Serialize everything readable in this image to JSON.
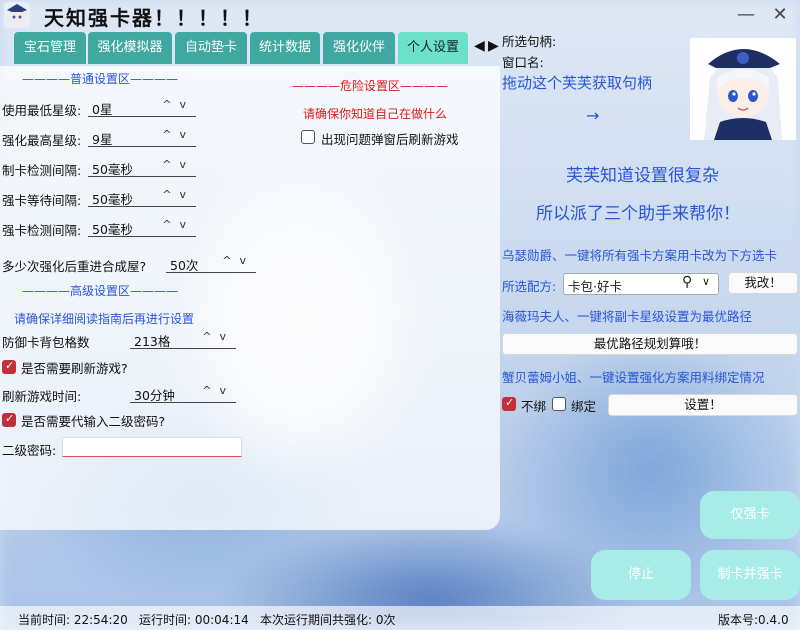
{
  "app": {
    "title": "天知强卡器！！！！！",
    "minimize_label": "—",
    "close_label": "✕"
  },
  "tabs": [
    {
      "label": "宝石管理"
    },
    {
      "label": "强化模拟器"
    },
    {
      "label": "自动垫卡"
    },
    {
      "label": "统计数据"
    },
    {
      "label": "强化伙伴"
    },
    {
      "label": "个人设置"
    }
  ],
  "active_tab": "个人设置",
  "normal_settings": {
    "title": "————普通设置区————",
    "rows": [
      {
        "label": "使用最低星级:",
        "value": "0星"
      },
      {
        "label": "强化最高星级:",
        "value": "9星"
      },
      {
        "label": "制卡检测间隔:",
        "value": "50毫秒"
      },
      {
        "label": "强卡等待间隔:",
        "value": "50毫秒"
      },
      {
        "label": "强卡检测间隔:",
        "value": "50毫秒"
      }
    ],
    "merge": {
      "label": "多少次强化后重进合成屋?",
      "value": "50次"
    }
  },
  "danger_settings": {
    "title": "————危险设置区————",
    "warning": "请确保你知道自己在做什么",
    "refresh_checkbox": {
      "label": "出现问题弹窗后刷新游戏",
      "checked": false
    }
  },
  "advanced_settings": {
    "title": "————高级设置区————",
    "note": "请确保详细阅读指南后再进行设置",
    "defense_bag": {
      "label": "防御卡背包格数",
      "value": "213格"
    },
    "need_refresh": {
      "label": "是否需要刷新游戏?",
      "checked": true
    },
    "refresh_time": {
      "label": "刷新游戏时间:",
      "value": "30分钟"
    },
    "need_pwd": {
      "label": "是否需要代输入二级密码?",
      "checked": true
    },
    "pwd": {
      "label": "二级密码:",
      "value": ""
    }
  },
  "right": {
    "handle_label": "所选句柄:",
    "window_label": "窗口名:",
    "drag_hint": "拖动这个芙芙获取句柄",
    "arrow": "→",
    "line1": "芙芙知道设置很复杂",
    "line2": "所以派了三个助手来帮你！",
    "helper1": "乌瑟勋爵、一键将所有强卡方案用卡改为下方选卡",
    "recipe_label": "所选配方:",
    "recipe_value": "卡包·好卡",
    "change_button": "我改！",
    "helper2": "海薇玛夫人、一键将副卡星级设置为最优路径",
    "optimal_button": "最优路径规划算哦！",
    "helper3": "蟹贝蕾姆小姐、一键设置强化方案用料绑定情况",
    "unbound": {
      "label": "不绑",
      "checked": true
    },
    "bound": {
      "label": "绑定",
      "checked": false
    },
    "set_button": "设置！"
  },
  "actions": {
    "only_enhance": "仅强卡",
    "stop": "停止",
    "make_and_enhance": "制卡并强卡"
  },
  "status": {
    "current_time": "当前时间: 22:54:20",
    "run_time": "运行时间: 00:04:14",
    "enhance_count": "本次运行期间共强化: 0次",
    "version": "版本号:0.4.0"
  },
  "colors": {
    "accent_blue": "#2a55d6",
    "warning_red": "#e01818",
    "tab": "#3fa8a0",
    "tab_active": "#6ce0c8",
    "action_button": "#a8ece8"
  }
}
